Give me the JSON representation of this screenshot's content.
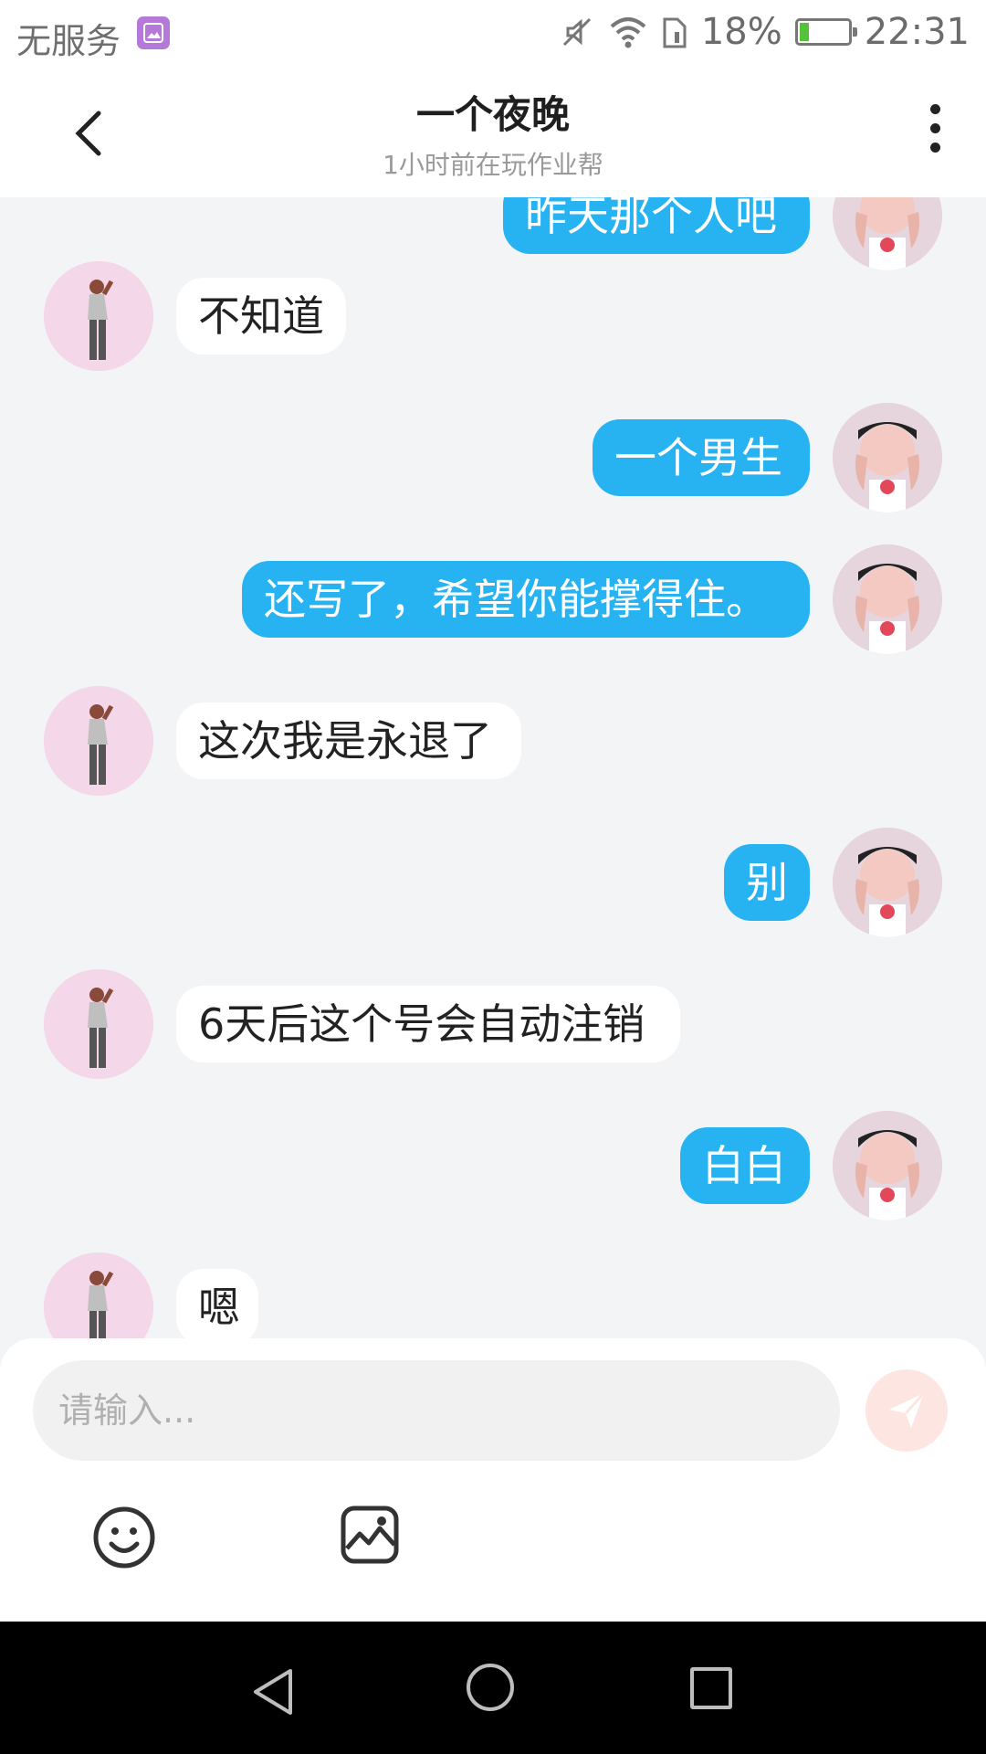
{
  "status_bar": {
    "carrier": "无服务",
    "battery_percent": "18%",
    "battery_level": 0.18,
    "time": "22:31",
    "icons": [
      "photo-notification-icon",
      "mute-icon",
      "wifi-icon",
      "sim-icon",
      "battery-charging-icon"
    ]
  },
  "header": {
    "title": "一个夜晚",
    "subtitle": "1小时前在玩作业帮",
    "back_icon": "chevron-left-icon",
    "more_icon": "more-vertical-icon"
  },
  "messages": [
    {
      "sender": "me",
      "text": "昨天那个人吧"
    },
    {
      "sender": "other",
      "text": "不知道"
    },
    {
      "sender": "me",
      "text": "一个男生"
    },
    {
      "sender": "me",
      "text": "还写了，希望你能撑得住。"
    },
    {
      "sender": "other",
      "text": "这次我是永退了"
    },
    {
      "sender": "me",
      "text": "别"
    },
    {
      "sender": "other",
      "text": "6天后这个号会自动注销"
    },
    {
      "sender": "me",
      "text": "白白"
    },
    {
      "sender": "other",
      "text": "嗯"
    }
  ],
  "input": {
    "placeholder": "请输入...",
    "value": ""
  },
  "toolbar": {
    "send_icon": "send-icon",
    "emoji_icon": "emoji-icon",
    "image_icon": "image-icon"
  },
  "colors": {
    "my_bubble": "#27b3f2",
    "other_bubble": "#ffffff",
    "chat_background": "#f3f4f6",
    "send_button": "#fde5e1"
  }
}
